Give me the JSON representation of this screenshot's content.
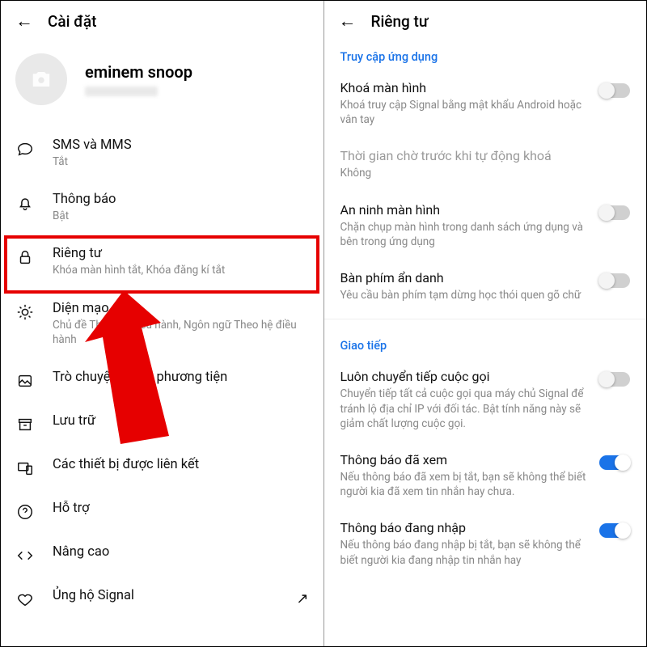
{
  "left": {
    "title": "Cài đặt",
    "profile": {
      "name": "eminem snoop"
    },
    "items": [
      {
        "label": "SMS và MMS",
        "sub": "Tắt"
      },
      {
        "label": "Thông báo",
        "sub": "Bật"
      },
      {
        "label": "Riêng tư",
        "sub": "Khóa màn hình tắt, Khóa đăng kí tắt"
      },
      {
        "label": "Diện mạo",
        "sub": "Chủ đề Theo hệ điều hành, Ngôn ngữ Theo hệ điều hành"
      },
      {
        "label": "Trò chuyện và đa phương tiện",
        "sub": ""
      },
      {
        "label": "Lưu trữ",
        "sub": ""
      },
      {
        "label": "Các thiết bị được liên kết",
        "sub": ""
      },
      {
        "label": "Hỗ trợ",
        "sub": ""
      },
      {
        "label": "Nâng cao",
        "sub": ""
      },
      {
        "label": "Ủng hộ Signal",
        "sub": ""
      }
    ]
  },
  "right": {
    "title": "Riêng tư",
    "section1": "Truy cập ứng dụng",
    "rows1": [
      {
        "title": "Khoá màn hình",
        "desc": "Khoá truy cập Signal bằng mật khẩu Android hoặc vân tay",
        "val": false
      },
      {
        "title": "Thời gian chờ trước khi tự động khoá",
        "desc": "Không",
        "disabled": true,
        "val": null
      },
      {
        "title": "An ninh màn hình",
        "desc": "Chặn chụp màn hình trong danh sách ứng dụng và bên trong ứng dụng",
        "val": false
      },
      {
        "title": "Bàn phím ẩn danh",
        "desc": "Yêu cầu bàn phím tạm dừng học thói quen gõ chữ",
        "val": false
      }
    ],
    "section2": "Giao tiếp",
    "rows2": [
      {
        "title": "Luôn chuyển tiếp cuộc gọi",
        "desc": "Chuyển tiếp tất cả cuộc gọi qua máy chủ Signal để tránh lộ địa chỉ IP với đối tác. Bật tính năng này sẽ giảm chất lượng cuộc gọi.",
        "val": false
      },
      {
        "title": "Thông báo đã xem",
        "desc": "Nếu thông báo đã xem bị tắt, bạn sẽ không thể biết người kia đã xem tin nhắn hay chưa.",
        "val": true
      },
      {
        "title": "Thông báo đang nhập",
        "desc": "Nếu thông báo đang nhập bị tắt, bạn sẽ không thể biết người kia đang nhập tin nhắn hay",
        "val": true
      }
    ]
  }
}
